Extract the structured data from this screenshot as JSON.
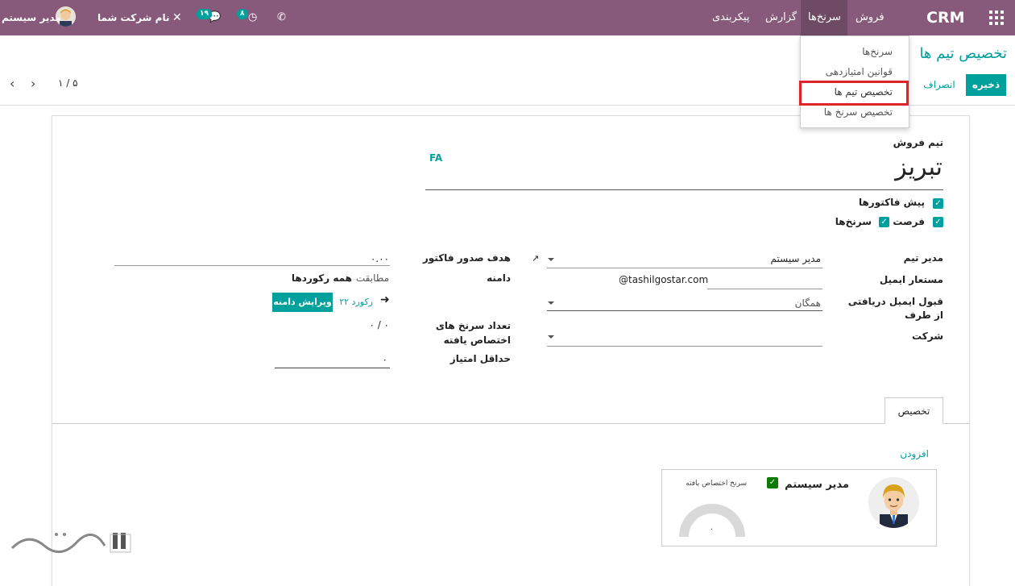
{
  "topbar": {
    "app_name": "CRM",
    "menu": [
      "فروش",
      "سرنخ‌ها",
      "گزارش",
      "پیکربندی"
    ],
    "user_name": "مدیر سیستم",
    "company": "نام شرکت شما",
    "activity_count": "۸",
    "message_count": "۱۹",
    "colors": {
      "bar": "#875a7b",
      "accent": "#00a09d"
    }
  },
  "dropdown": {
    "items": [
      "سرنخ‌ها",
      "قوانین امتیازدهی",
      "تخصیص تیم ها",
      "تخصیص سرنخ ها"
    ],
    "highlighted": "تخصیص تیم ها"
  },
  "control_panel": {
    "title": "تخصیص تیم ها",
    "save_label": "ذخیره",
    "discard_label": "انصراف",
    "pager": "۱ / ۵"
  },
  "form": {
    "team_label": "تیم فروش",
    "team_name": "تبریز",
    "lang_code": "FA",
    "check_quotations": "پیش فاکتورها",
    "check_opportunity": "فرصت",
    "check_leads": "سرنخ‌ها",
    "team_leader_label": "مدیر تیم",
    "team_leader_value": "مدیر سیستم",
    "email_alias_label": "مستعار ایمیل",
    "email_alias_value": "@tashilgostar.com",
    "accept_emails_label": "قبول ایمیل دریافتی از طرف",
    "accept_emails_value": "همگان",
    "company_label": "شرکت",
    "invoice_target_label": "هدف صدور فاکتور",
    "invoice_target_value": "۰.۰۰",
    "domain_label": "دامنه",
    "domain_value_prefix": "مطابقت",
    "domain_value_bold": "همه رکوردها",
    "records_count": "۲۲ رکورد",
    "edit_domain_label": "ویرایش دامنه",
    "assigned_leads_label": "تعداد سرنخ های اختصاص یافته",
    "assigned_leads_value": "۰ / ۰",
    "min_score_label": "حداقل امتیاز",
    "min_score_value": "۰"
  },
  "tabs": {
    "assignment": "تخصیص",
    "add_label": "افزودن"
  },
  "member_card": {
    "name": "مدیر سیستم",
    "assigned_label": "سرنخ اختصاص یافته",
    "gauge_value": "۰",
    "checked": true
  }
}
